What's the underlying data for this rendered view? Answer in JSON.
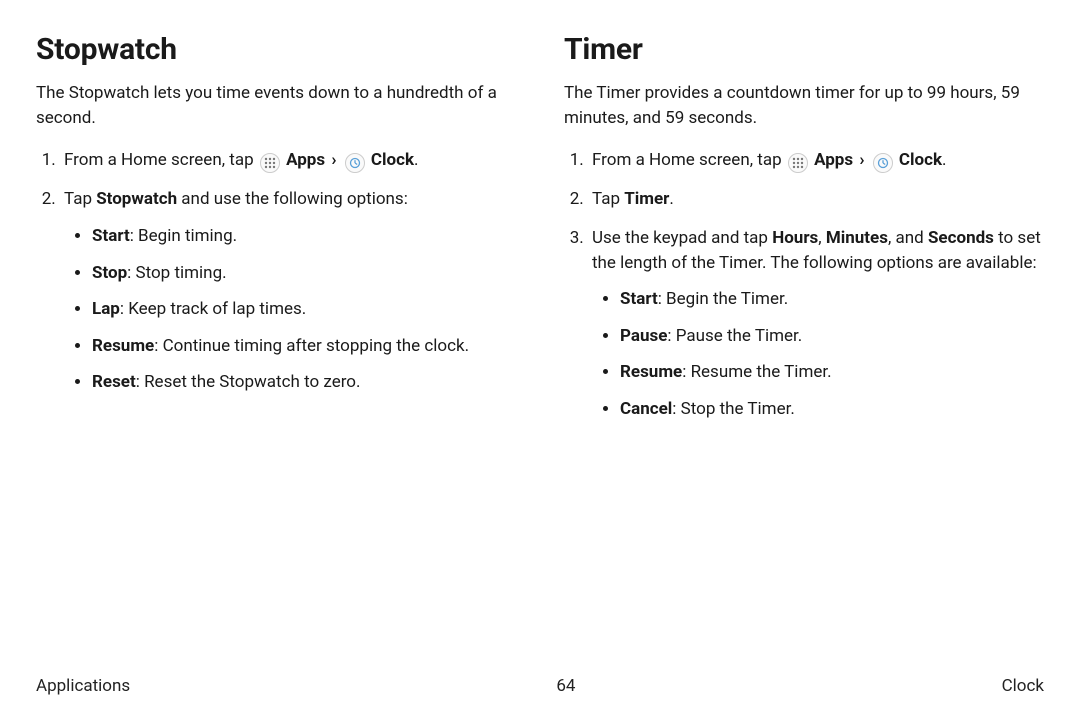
{
  "left": {
    "heading": "Stopwatch",
    "intro": "The Stopwatch lets you time events down to a hundredth of a second.",
    "step1_pre": "From a Home screen, tap ",
    "apps_label": "Apps",
    "clock_label": "Clock",
    "step1_post": ".",
    "step2_pre": "Tap ",
    "step2_bold": "Stopwatch",
    "step2_post": " and use the following options:",
    "opts": [
      {
        "term": "Start",
        "desc": ": Begin timing."
      },
      {
        "term": "Stop",
        "desc": ": Stop timing."
      },
      {
        "term": "Lap",
        "desc": ": Keep track of lap times."
      },
      {
        "term": "Resume",
        "desc": ": Continue timing after stopping the clock."
      },
      {
        "term": "Reset",
        "desc": ": Reset the Stopwatch to zero."
      }
    ]
  },
  "right": {
    "heading": "Timer",
    "intro": "The Timer provides a countdown timer for up to 99 hours, 59 minutes, and 59 seconds.",
    "step1_pre": "From a Home screen, tap ",
    "apps_label": "Apps",
    "clock_label": "Clock",
    "step1_post": ".",
    "step2_pre": "Tap ",
    "step2_bold": "Timer",
    "step2_post": ".",
    "step3_pre": "Use the keypad and tap ",
    "step3_b1": "Hours",
    "step3_mid1": ", ",
    "step3_b2": "Minutes",
    "step3_mid2": ", and ",
    "step3_b3": "Seconds",
    "step3_post": " to set the length of the Timer. The following options are available:",
    "opts": [
      {
        "term": "Start",
        "desc": ": Begin the Timer."
      },
      {
        "term": "Pause",
        "desc": ": Pause the Timer."
      },
      {
        "term": "Resume",
        "desc": ": Resume the Timer."
      },
      {
        "term": "Cancel",
        "desc": ": Stop the Timer."
      }
    ]
  },
  "footer": {
    "left": "Applications",
    "center": "64",
    "right": "Clock"
  }
}
